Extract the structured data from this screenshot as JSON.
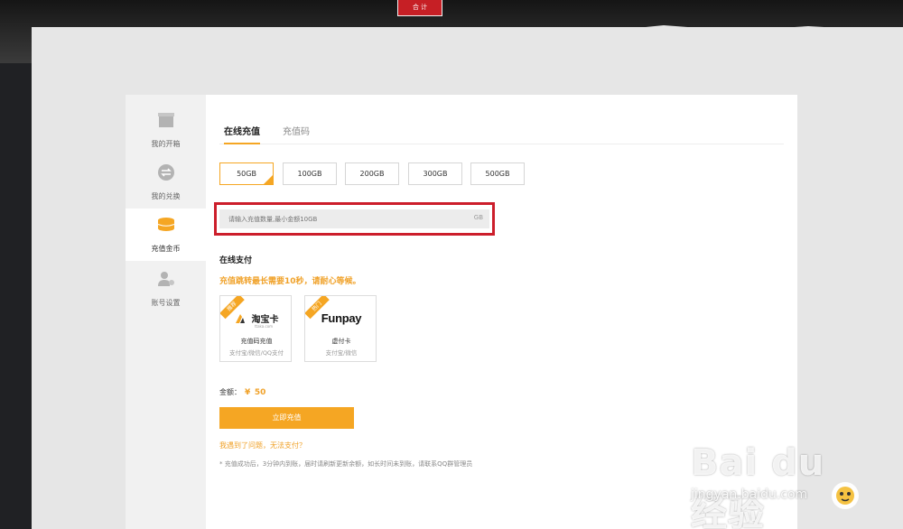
{
  "header": {
    "badge_text": "合 计"
  },
  "sidebar": {
    "items": [
      {
        "label": "我的开箱",
        "icon": "box-icon"
      },
      {
        "label": "我的兑换",
        "icon": "exchange-icon"
      },
      {
        "label": "充值金币",
        "icon": "coins-icon",
        "active": true
      },
      {
        "label": "账号设置",
        "icon": "user-settings-icon"
      }
    ]
  },
  "tabs": [
    {
      "label": "在线充值",
      "active": true
    },
    {
      "label": "充值码",
      "active": false
    }
  ],
  "amounts": [
    {
      "label": "50GB",
      "selected": true
    },
    {
      "label": "100GB",
      "selected": false
    },
    {
      "label": "200GB",
      "selected": false
    },
    {
      "label": "300GB",
      "selected": false
    },
    {
      "label": "500GB",
      "selected": false
    }
  ],
  "custom_amount": {
    "placeholder": "请输入充值数量,最小金额10GB",
    "unit": "GB"
  },
  "payment": {
    "section_title": "在线支付",
    "notice": "充值跳转最长需要10秒，请耐心等候。",
    "methods": [
      {
        "ribbon": "推荐",
        "logo": "淘宝卡",
        "logo_sub": "ttaka.com",
        "name": "充值码充值",
        "sub": "支付宝/微信/QQ支付"
      },
      {
        "ribbon": "热门",
        "logo": "Funpay",
        "name": "虚付卡",
        "sub": "支付宝/微信"
      }
    ]
  },
  "total": {
    "label": "金额：",
    "currency": "¥",
    "value": "50"
  },
  "submit_label": "立即充值",
  "help_link": "我遇到了问题，无法支付？",
  "footnote": "* 充值成功后，3分钟内到账，届时请刷新更新余额，如长时间未到账，请联系QQ群管理员",
  "watermark": {
    "brand": "Bai du 经验",
    "url": "jingyan.baidu.com"
  },
  "colors": {
    "accent": "#f5a623",
    "highlight_border": "#cc1e2b"
  }
}
